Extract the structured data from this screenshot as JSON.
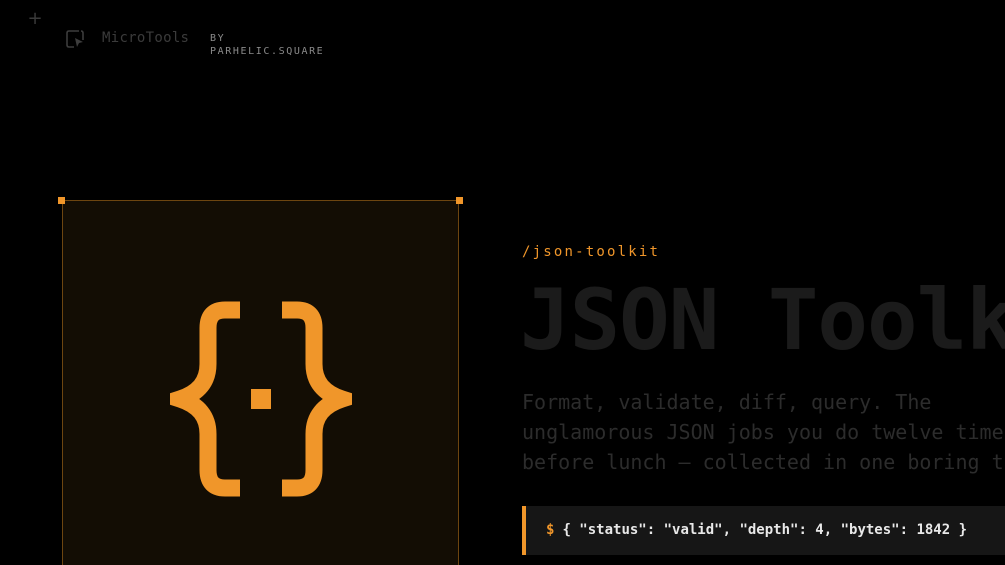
{
  "header": {
    "plus_glyph": "+",
    "brand_icon": "square-cursor-logo-icon",
    "brand_name": "MicroTools",
    "byline_prefix": "BY",
    "byline_company": "PARHELIC.SQUARE"
  },
  "product": {
    "icon": "curly-braces-icon",
    "path": "/json-toolkit",
    "title": "JSON Toolkit",
    "description": "Format, validate, diff, query. The unglamorous JSON jobs you do twelve times before lunch — collected in one boring tab.",
    "terminal": {
      "prompt": "$",
      "output": "{ \"status\": \"valid\", \"depth\": 4, \"bytes\": 1842 }"
    }
  },
  "colors": {
    "accent": "#f0962a",
    "background": "#000000",
    "card_background": "#130d04",
    "terminal_background": "#161616"
  }
}
